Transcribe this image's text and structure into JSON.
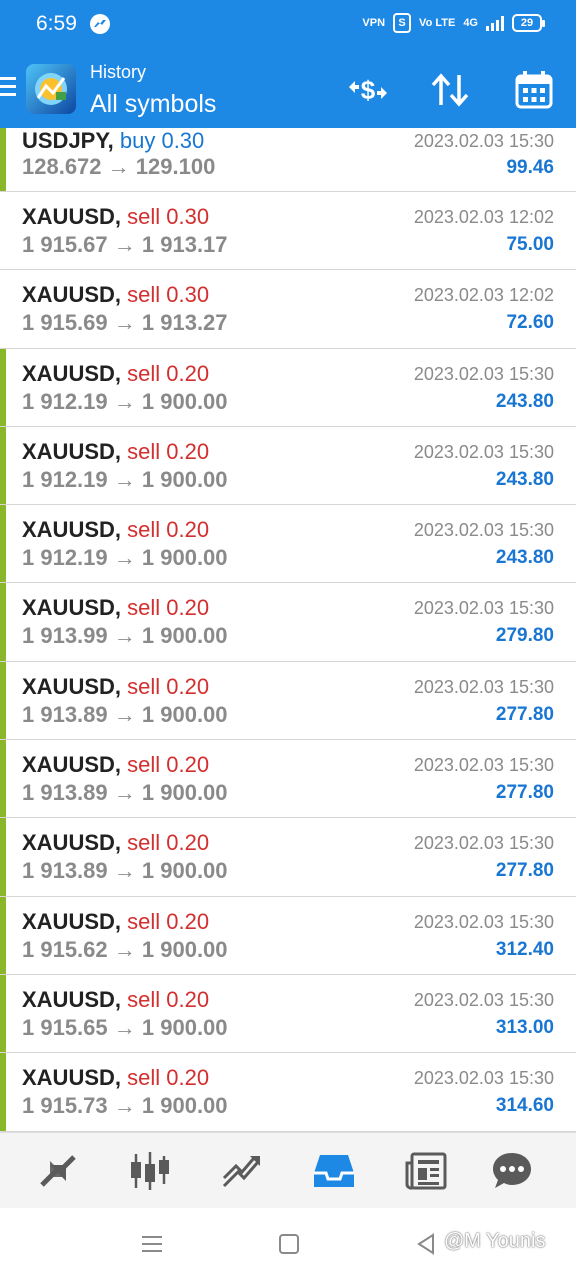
{
  "status_bar": {
    "time": "6:59",
    "battery": "29",
    "vpn_label": "VPN",
    "volte_label": "Vo LTE",
    "network_label": "4G"
  },
  "app_bar": {
    "title": "History",
    "subtitle": "All symbols",
    "actions": [
      "currency-exchange-icon",
      "sort-icon",
      "calendar-icon"
    ]
  },
  "deals": [
    {
      "symbol": "USDJPY,",
      "side": "buy",
      "volume": "0.30",
      "open": "128.672",
      "close": "129.100",
      "time": "2023.02.03 15:30",
      "profit": "99.46",
      "accent": true
    },
    {
      "symbol": "XAUUSD,",
      "side": "sell",
      "volume": "0.30",
      "open": "1 915.67",
      "close": "1 913.17",
      "time": "2023.02.03 12:02",
      "profit": "75.00",
      "accent": false
    },
    {
      "symbol": "XAUUSD,",
      "side": "sell",
      "volume": "0.30",
      "open": "1 915.69",
      "close": "1 913.27",
      "time": "2023.02.03 12:02",
      "profit": "72.60",
      "accent": false
    },
    {
      "symbol": "XAUUSD,",
      "side": "sell",
      "volume": "0.20",
      "open": "1 912.19",
      "close": "1 900.00",
      "time": "2023.02.03 15:30",
      "profit": "243.80",
      "accent": true
    },
    {
      "symbol": "XAUUSD,",
      "side": "sell",
      "volume": "0.20",
      "open": "1 912.19",
      "close": "1 900.00",
      "time": "2023.02.03 15:30",
      "profit": "243.80",
      "accent": true
    },
    {
      "symbol": "XAUUSD,",
      "side": "sell",
      "volume": "0.20",
      "open": "1 912.19",
      "close": "1 900.00",
      "time": "2023.02.03 15:30",
      "profit": "243.80",
      "accent": true
    },
    {
      "symbol": "XAUUSD,",
      "side": "sell",
      "volume": "0.20",
      "open": "1 913.99",
      "close": "1 900.00",
      "time": "2023.02.03 15:30",
      "profit": "279.80",
      "accent": true
    },
    {
      "symbol": "XAUUSD,",
      "side": "sell",
      "volume": "0.20",
      "open": "1 913.89",
      "close": "1 900.00",
      "time": "2023.02.03 15:30",
      "profit": "277.80",
      "accent": true
    },
    {
      "symbol": "XAUUSD,",
      "side": "sell",
      "volume": "0.20",
      "open": "1 913.89",
      "close": "1 900.00",
      "time": "2023.02.03 15:30",
      "profit": "277.80",
      "accent": true
    },
    {
      "symbol": "XAUUSD,",
      "side": "sell",
      "volume": "0.20",
      "open": "1 913.89",
      "close": "1 900.00",
      "time": "2023.02.03 15:30",
      "profit": "277.80",
      "accent": true
    },
    {
      "symbol": "XAUUSD,",
      "side": "sell",
      "volume": "0.20",
      "open": "1 915.62",
      "close": "1 900.00",
      "time": "2023.02.03 15:30",
      "profit": "312.40",
      "accent": true
    },
    {
      "symbol": "XAUUSD,",
      "side": "sell",
      "volume": "0.20",
      "open": "1 915.65",
      "close": "1 900.00",
      "time": "2023.02.03 15:30",
      "profit": "313.00",
      "accent": true
    },
    {
      "symbol": "XAUUSD,",
      "side": "sell",
      "volume": "0.20",
      "open": "1 915.73",
      "close": "1 900.00",
      "time": "2023.02.03 15:30",
      "profit": "314.60",
      "accent": true
    }
  ],
  "arrow": "→",
  "bottom_nav": {
    "items": [
      "quotes-icon",
      "chart-icon",
      "trade-icon",
      "history-icon",
      "news-icon",
      "chat-icon"
    ],
    "active": "history-icon"
  },
  "system_nav": {
    "watermark": "@M Younis"
  },
  "colors": {
    "primary": "#1e88e5",
    "sell": "#d32f2f",
    "buy": "#1976d2",
    "profit": "#1976d2",
    "accent_bar": "#8ab62a",
    "active_nav": "#1e88e5",
    "inactive_nav": "#5a5a5a"
  }
}
